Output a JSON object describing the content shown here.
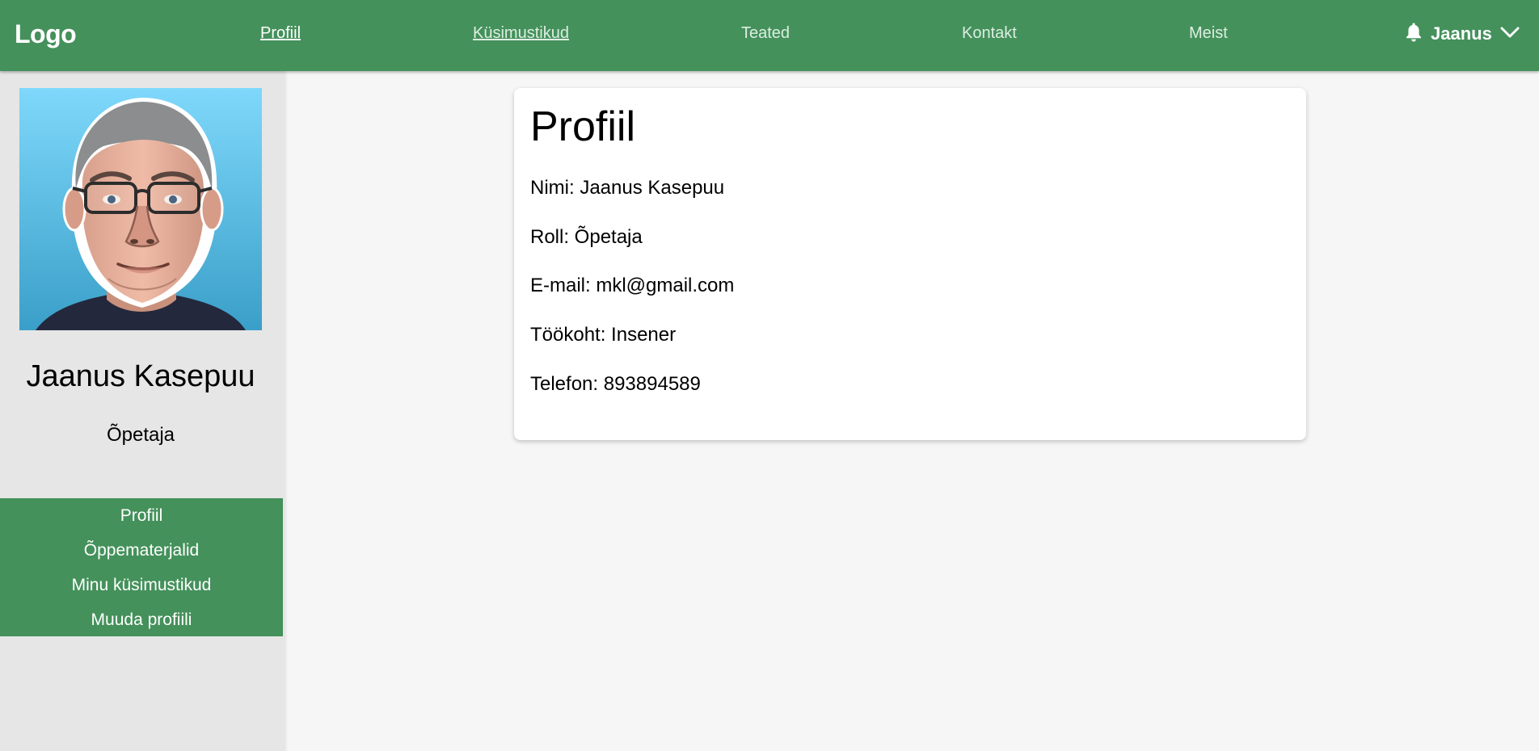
{
  "header": {
    "logo": "Logo",
    "nav": [
      {
        "label": "Profiil"
      },
      {
        "label": "Küsimustikud"
      },
      {
        "label": "Teated"
      },
      {
        "label": "Kontakt"
      },
      {
        "label": "Meist"
      }
    ],
    "user_name": "Jaanus",
    "icons": {
      "notification": "bell-icon",
      "dropdown": "chevron-down-icon"
    }
  },
  "sidebar": {
    "name": "Jaanus Kasepuu",
    "role": "Õpetaja",
    "menu": [
      {
        "label": "Profiil"
      },
      {
        "label": "Õppematerjalid"
      },
      {
        "label": "Minu küsimustikud"
      },
      {
        "label": "Muuda profiili"
      }
    ]
  },
  "profile": {
    "title": "Profiil",
    "fields": [
      {
        "text": "Nimi: Jaanus Kasepuu"
      },
      {
        "text": "Roll: Õpetaja"
      },
      {
        "text": "E-mail: mkl@gmail.com"
      },
      {
        "text": "Töökoht: Insener"
      },
      {
        "text": "Telefon: 893894589"
      }
    ]
  },
  "colors": {
    "brand_green": "#44915b",
    "sidebar_bg": "#e6e6e6",
    "page_bg": "#f6f6f6"
  }
}
